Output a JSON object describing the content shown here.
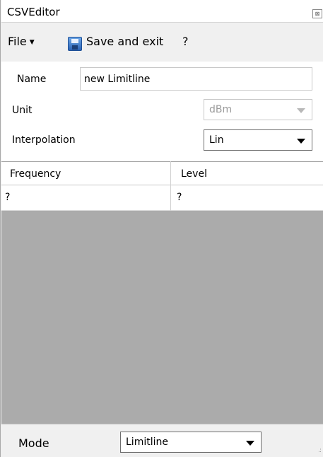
{
  "window": {
    "title": "CSVEditor",
    "close_glyph": "⊠"
  },
  "menu": {
    "file_label": "File",
    "file_caret": "▼",
    "save_label": "Save and exit",
    "help_label": "?"
  },
  "form": {
    "name_label": "Name",
    "name_value": "new Limitline",
    "unit_label": "Unit",
    "unit_value": "dBm",
    "interpolation_label": "Interpolation",
    "interpolation_value": "Lin"
  },
  "table": {
    "columns": [
      "Frequency",
      "Level"
    ],
    "rows": [
      [
        "?",
        "?"
      ]
    ]
  },
  "bottom": {
    "mode_label": "Mode",
    "mode_value": "Limitline",
    "grip_glyph": ".:"
  },
  "colors": {
    "grid_empty_area": "#ababab",
    "window_background": "#f0f0f0"
  }
}
